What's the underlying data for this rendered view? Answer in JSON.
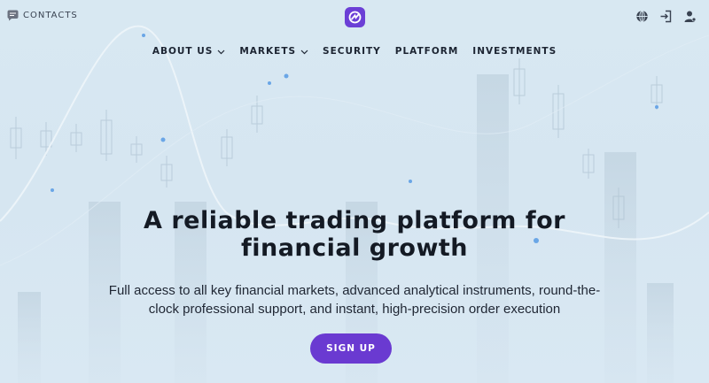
{
  "topbar": {
    "contacts_label": "CONTACTS",
    "contacts_icon": "chat-icon",
    "logo_icon": "brand-logo-icon",
    "right_icons": [
      "globe-icon",
      "login-icon",
      "user-icon"
    ]
  },
  "nav": {
    "items": [
      {
        "label": "ABOUT US",
        "dropdown": true
      },
      {
        "label": "MARKETS",
        "dropdown": true
      },
      {
        "label": "SECURITY",
        "dropdown": false
      },
      {
        "label": "PLATFORM",
        "dropdown": false
      },
      {
        "label": "INVESTMENTS",
        "dropdown": false
      }
    ]
  },
  "hero": {
    "title_line1": "A reliable trading platform for",
    "title_line2": "financial growth",
    "subtitle_line1": "Full access to all key financial markets, advanced analytical instruments, round-the-",
    "subtitle_line2": "clock professional support, and instant, high-precision order execution",
    "cta_label": "SIGN UP"
  },
  "colors": {
    "accent": "#6a3ad1",
    "background": "#d8e8f2",
    "text": "#141a24"
  }
}
